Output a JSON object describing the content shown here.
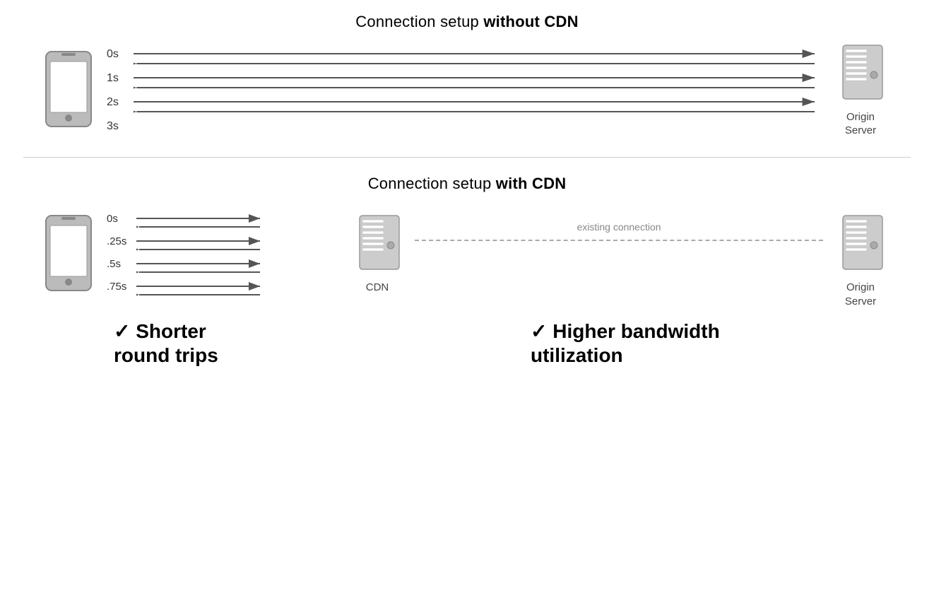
{
  "top_section": {
    "title_normal": "Connection setup ",
    "title_bold": "without CDN",
    "time_labels": [
      "0s",
      "1s",
      "2s",
      "3s"
    ],
    "server_label": "Origin\nServer"
  },
  "bottom_section": {
    "title_normal": "Connection setup ",
    "title_bold": "with CDN",
    "time_labels": [
      "0s",
      ".25s",
      ".5s",
      ".75s"
    ],
    "cdn_label": "CDN",
    "server_label": "Origin\nServer",
    "existing_connection_label": "existing connection",
    "benefit1": "✓ Shorter\nround trips",
    "benefit2": "✓ Higher bandwidth\nutilization"
  }
}
